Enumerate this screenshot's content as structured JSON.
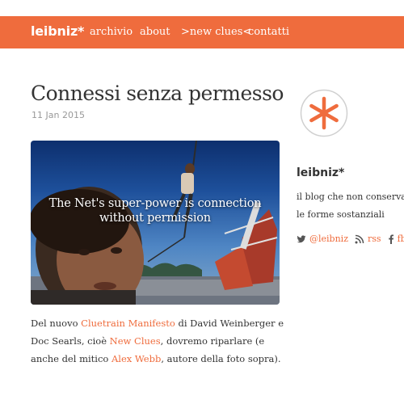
{
  "header": {
    "brand": "leibniz*",
    "nav": [
      "archivio",
      "about",
      ">new clues<",
      "contatti"
    ]
  },
  "post": {
    "title": "Connessi senza permesso",
    "date": "11 Jan 2015",
    "image_caption_line1": "The Net's super-power is connection",
    "image_caption_line2": "without permission",
    "body": {
      "t1": "Del nuovo ",
      "link1": "Cluetrain Manifesto",
      "t2": " di David Weinberger e Doc Searls, cioè ",
      "link2": "New Clues",
      "t3": ", dovremo riparlare (e anche del mitico ",
      "link3": "Alex Webb",
      "t4": ", autore della foto sopra)."
    }
  },
  "sidebar": {
    "logo_icon": "asterisk-logo",
    "title": "leibniz*",
    "description_line1": "il blog che non conserva",
    "description_line2": "le forme sostanziali",
    "social": [
      {
        "icon": "twitter-icon",
        "label": "@leibniz"
      },
      {
        "icon": "rss-icon",
        "label": "rss"
      },
      {
        "icon": "facebook-icon",
        "label": "fb"
      }
    ]
  },
  "colors": {
    "accent": "#ef6c3d",
    "text": "#333333",
    "muted": "#999999"
  }
}
